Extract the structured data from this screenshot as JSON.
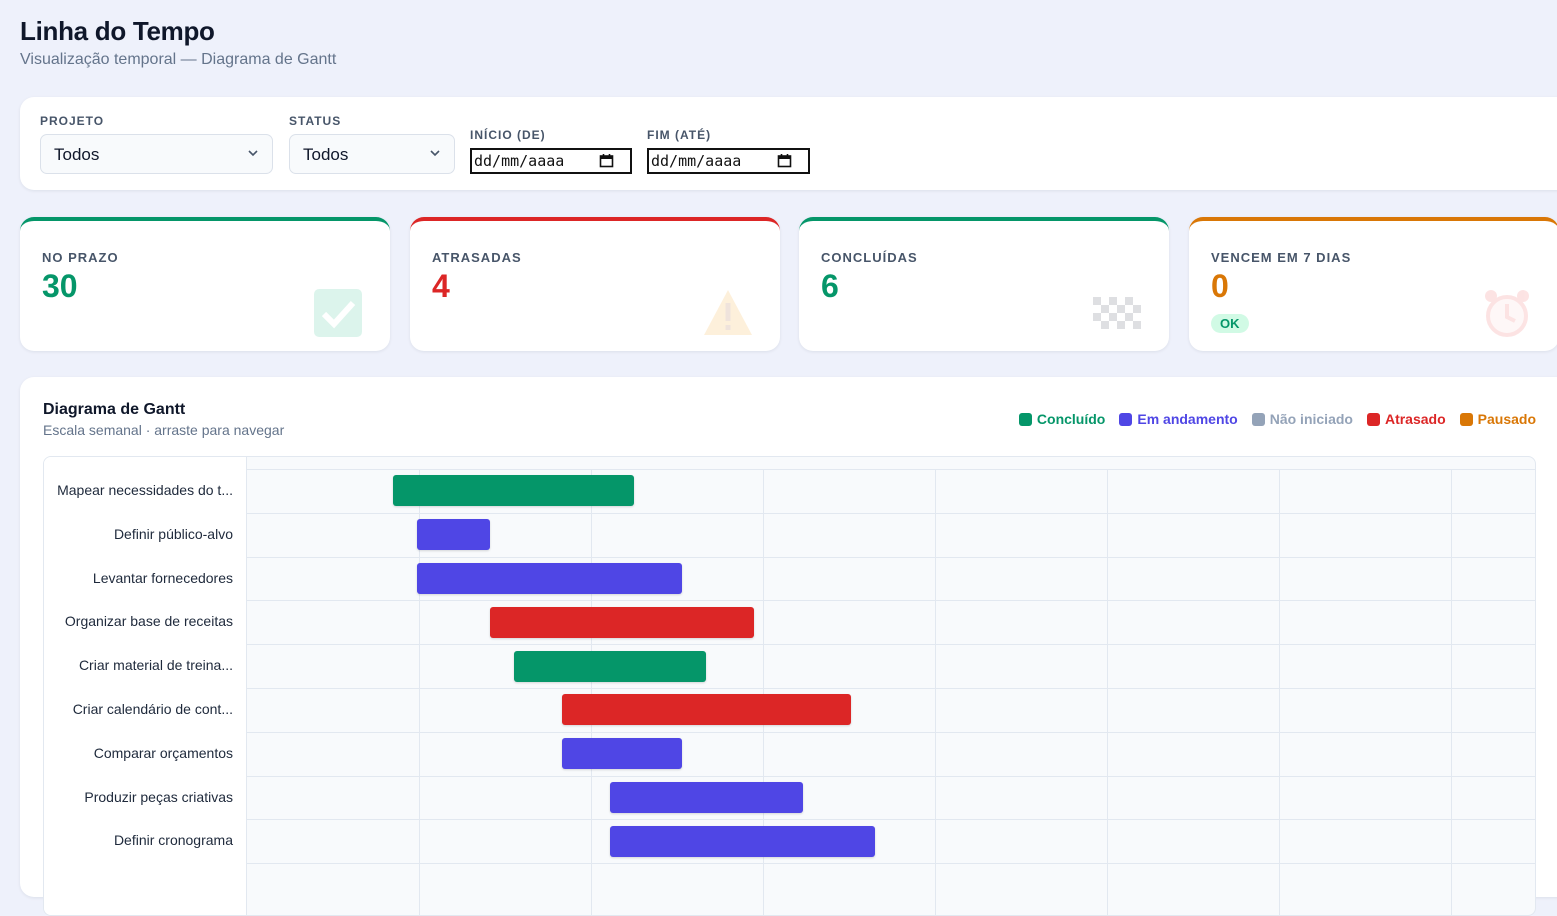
{
  "header": {
    "title": "Linha do Tempo",
    "subtitle": "Visualização temporal — Diagrama de Gantt"
  },
  "filters": {
    "projeto_label": "PROJETO",
    "projeto_value": "Todos",
    "status_label": "STATUS",
    "status_value": "Todos",
    "inicio_label": "INÍCIO (DE)",
    "inicio_placeholder": "dd/mm/aaaa",
    "fim_label": "FIM (ATÉ)",
    "fim_placeholder": "dd/mm/aaaa"
  },
  "stats": [
    {
      "label": "NO PRAZO",
      "value": "30",
      "color": "#059669",
      "icon": "check-icon"
    },
    {
      "label": "ATRASADAS",
      "value": "4",
      "color": "#dc2626",
      "icon": "warning-icon"
    },
    {
      "label": "CONCLUÍDAS",
      "value": "6",
      "color": "#059669",
      "icon": "checkered-flag-icon"
    },
    {
      "label": "VENCEM EM 7 DIAS",
      "value": "0",
      "color": "#d97706",
      "icon": "alarm-clock-icon",
      "badge": "OK"
    }
  ],
  "gantt": {
    "title": "Diagrama de Gantt",
    "subtitle": "Escala semanal · arraste para navegar",
    "legend": [
      {
        "label": "Concluído",
        "color": "#059669"
      },
      {
        "label": "Em andamento",
        "color": "#4f46e5"
      },
      {
        "label": "Não iniciado",
        "color": "#94a3b8"
      },
      {
        "label": "Atrasado",
        "color": "#dc2626"
      },
      {
        "label": "Pausado",
        "color": "#d97706"
      }
    ],
    "tasks": [
      {
        "name": "Mapear necessidades do t...",
        "status": "Concluído",
        "start": 0.85,
        "end": 2.25
      },
      {
        "name": "Definir público-alvo",
        "status": "Em andamento",
        "start": 0.99,
        "end": 1.41
      },
      {
        "name": "Levantar fornecedores",
        "status": "Em andamento",
        "start": 0.99,
        "end": 2.53
      },
      {
        "name": "Organizar base de receitas",
        "status": "Atrasado",
        "start": 1.41,
        "end": 2.95
      },
      {
        "name": "Criar material de treina...",
        "status": "Concluído",
        "start": 1.55,
        "end": 2.67
      },
      {
        "name": "Criar calendário de cont...",
        "status": "Atrasado",
        "start": 1.83,
        "end": 3.51
      },
      {
        "name": "Comparar orçamentos",
        "status": "Em andamento",
        "start": 1.83,
        "end": 2.53
      },
      {
        "name": "Produzir peças criativas",
        "status": "Em andamento",
        "start": 2.11,
        "end": 3.23
      },
      {
        "name": "Definir cronograma",
        "status": "Em andamento",
        "start": 2.11,
        "end": 3.65
      }
    ]
  }
}
